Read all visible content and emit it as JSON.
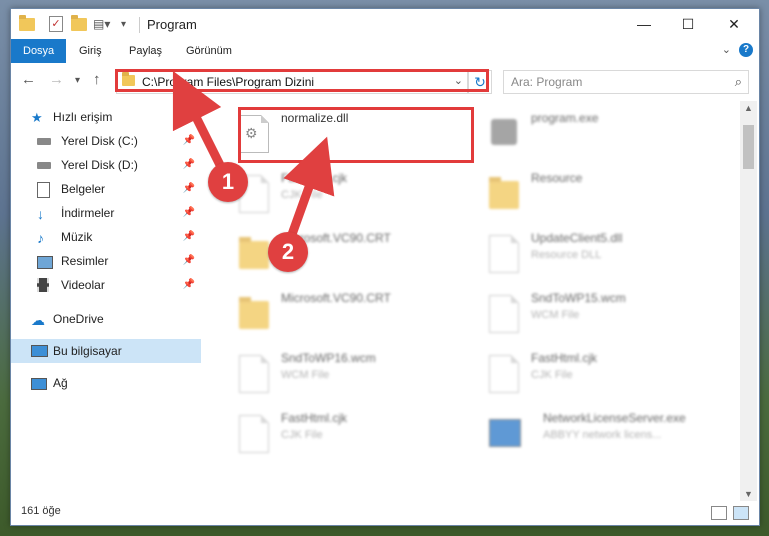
{
  "window": {
    "title": "Program"
  },
  "titlebar": {
    "minimize": "—",
    "maximize": "☐",
    "close": "✕"
  },
  "ribbon": {
    "tabs": [
      "Dosya",
      "Giriş",
      "Paylaş",
      "Görünüm"
    ]
  },
  "nav": {
    "address": "C:\\Program Files\\Program Dizini",
    "search_placeholder": "Ara: Program"
  },
  "sidebar": {
    "items": [
      {
        "label": "Hızlı erişim",
        "icon": "star-icon"
      },
      {
        "label": "Yerel Disk (C:)",
        "icon": "drive-icon"
      },
      {
        "label": "Yerel Disk (D:)",
        "icon": "drive-icon"
      },
      {
        "label": "Belgeler",
        "icon": "documents-icon"
      },
      {
        "label": "İndirmeler",
        "icon": "download-icon"
      },
      {
        "label": "Müzik",
        "icon": "music-icon"
      },
      {
        "label": "Resimler",
        "icon": "pictures-icon"
      },
      {
        "label": "Videolar",
        "icon": "video-icon"
      },
      {
        "label": "OneDrive",
        "icon": "cloud-icon"
      },
      {
        "label": "Bu bilgisayar",
        "icon": "computer-icon"
      },
      {
        "label": "Ağ",
        "icon": "network-icon"
      }
    ]
  },
  "files": [
    {
      "name": "normalize.dll",
      "type": ""
    },
    {
      "name": "program.exe",
      "type": ""
    },
    {
      "name": "FastHtml.cjk",
      "type": "CJK File"
    },
    {
      "name": "Resource",
      "type": ""
    },
    {
      "name": "Microsoft.VC90.CRT",
      "type": ""
    },
    {
      "name": "UpdateClient5.dll",
      "type": "Resource DLL"
    },
    {
      "name": "Microsoft.VC90.CRT",
      "type": ""
    },
    {
      "name": "SndToWP15.wcm",
      "type": "WCM File"
    },
    {
      "name": "SndToWP16.wcm",
      "type": "WCM File"
    },
    {
      "name": "FastHtml.cjk",
      "type": "CJK File"
    },
    {
      "name": "FastHtml.cjk",
      "type": "CJK File"
    },
    {
      "name": "NetworkLicenseServer.exe",
      "type": "ABBYY network licens..."
    }
  ],
  "status": {
    "item_count": "161 öğe"
  },
  "markers": {
    "one": "1",
    "two": "2"
  },
  "colors": {
    "accent": "#1979ca",
    "highlight": "#e23b3b"
  }
}
